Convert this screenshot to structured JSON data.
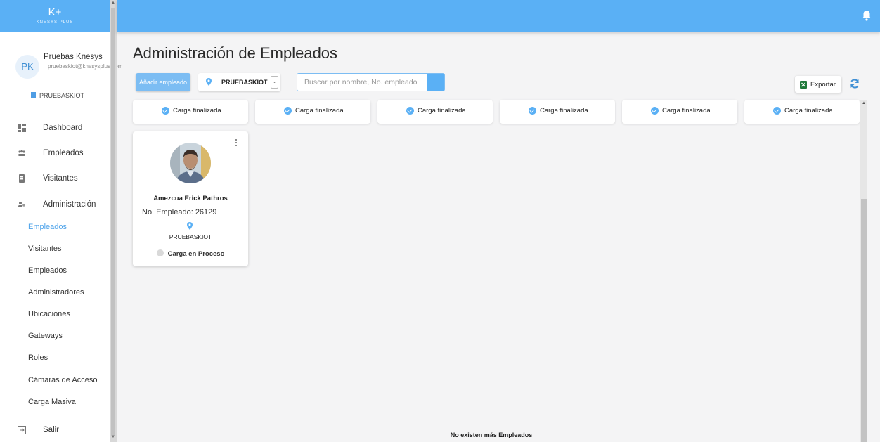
{
  "brand": {
    "mark": "K+",
    "text": "KNESYS PLUS"
  },
  "profile": {
    "initials": "PK",
    "name": "Pruebas Knesys",
    "email": "pruebaskiot@knesysplus.com",
    "location": "PRUEBASKIOT"
  },
  "nav": {
    "items": [
      {
        "label": "Dashboard",
        "icon": "dashboard-icon"
      },
      {
        "label": "Empleados",
        "icon": "people-icon"
      },
      {
        "label": "Visitantes",
        "icon": "badge-icon"
      },
      {
        "label": "Administración",
        "icon": "admin-icon"
      }
    ],
    "subitems": [
      {
        "label": "Empleados"
      },
      {
        "label": "Visitantes"
      },
      {
        "label": "Empleados"
      },
      {
        "label": "Administradores"
      },
      {
        "label": "Ubicaciones"
      },
      {
        "label": "Gateways"
      },
      {
        "label": "Roles"
      },
      {
        "label": "Cámaras de Acceso"
      },
      {
        "label": "Carga Masiva"
      }
    ],
    "logout": {
      "label": "Salir",
      "icon": "logout-icon"
    }
  },
  "page": {
    "title": "Administración de Empleados"
  },
  "toolbar": {
    "add_label": "Añadir empleado",
    "location_value": "PRUEBASKIOT",
    "search_placeholder": "Buscar por nombre, No. empleado",
    "export_label": "Exportar"
  },
  "status_cards": [
    {
      "label": "Carga finalizada"
    },
    {
      "label": "Carga finalizada"
    },
    {
      "label": "Carga finalizada"
    },
    {
      "label": "Carga finalizada"
    },
    {
      "label": "Carga finalizada"
    },
    {
      "label": "Carga finalizada"
    }
  ],
  "employee": {
    "name": "Amezcua Erick Pathros",
    "number_label": "No. Empleado: 26129",
    "location": "PRUEBASKIOT",
    "status": "Carga en Proceso"
  },
  "footer": {
    "message": "No existen más Empleados"
  },
  "colors": {
    "primary": "#5ab0f5",
    "button": "#7cbdf3",
    "active_link": "#4ea3ea",
    "excel": "#1f7a3a"
  }
}
